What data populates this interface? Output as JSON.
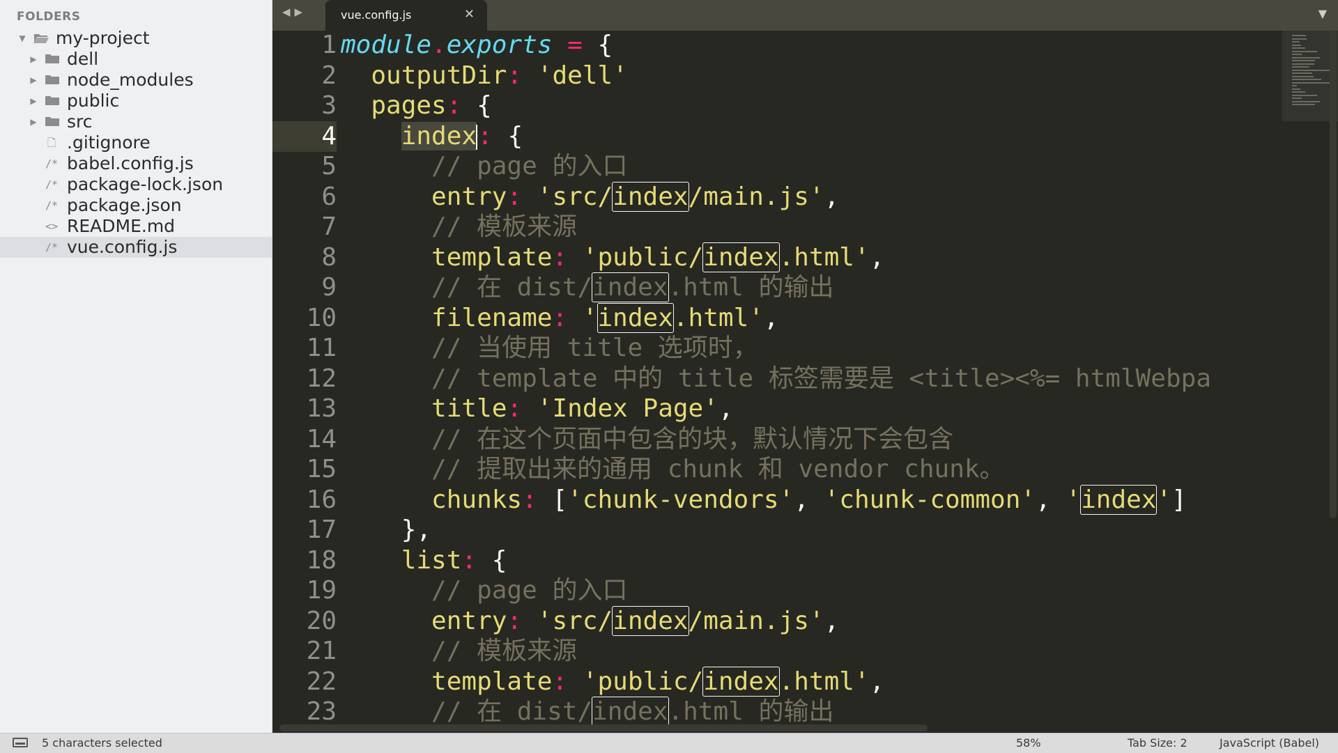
{
  "sidebar": {
    "header": "FOLDERS",
    "items": [
      {
        "label": "my-project",
        "type": "folder-open",
        "depth": 0
      },
      {
        "label": "dell",
        "type": "folder",
        "depth": 1
      },
      {
        "label": "node_modules",
        "type": "folder",
        "depth": 1
      },
      {
        "label": "public",
        "type": "folder",
        "depth": 1
      },
      {
        "label": "src",
        "type": "folder",
        "depth": 1
      },
      {
        "label": ".gitignore",
        "type": "file",
        "icon_glyph": "🗋",
        "depth": 1
      },
      {
        "label": "babel.config.js",
        "type": "file",
        "icon_glyph": "/*",
        "depth": 1
      },
      {
        "label": "package-lock.json",
        "type": "file",
        "icon_glyph": "/*",
        "depth": 1
      },
      {
        "label": "package.json",
        "type": "file",
        "icon_glyph": "/*",
        "depth": 1
      },
      {
        "label": "README.md",
        "type": "file",
        "icon_glyph": "<>",
        "depth": 1
      },
      {
        "label": "vue.config.js",
        "type": "file",
        "icon_glyph": "/*",
        "depth": 1,
        "selected": true
      }
    ]
  },
  "tabbar": {
    "nav_back": "◀",
    "nav_forward": "▶",
    "active_tab": "vue.config.js",
    "close_glyph": "✕",
    "dropdown_glyph": "▼"
  },
  "editor": {
    "current_line": 4,
    "lines": [
      {
        "n": "1",
        "tokens": [
          [
            "kw",
            "module"
          ],
          [
            "op",
            "."
          ],
          [
            "kw",
            "exports"
          ],
          [
            "punc",
            " "
          ],
          [
            "op",
            "="
          ],
          [
            "punc",
            " {"
          ]
        ]
      },
      {
        "n": "2",
        "tokens": [
          [
            "punc",
            "  "
          ],
          [
            "key",
            "outputDir"
          ],
          [
            "op",
            ":"
          ],
          [
            "punc",
            " "
          ],
          [
            "str",
            "'dell'"
          ]
        ]
      },
      {
        "n": "3",
        "tokens": [
          [
            "punc",
            "  "
          ],
          [
            "key",
            "pages"
          ],
          [
            "op",
            ":"
          ],
          [
            "punc",
            " {"
          ]
        ]
      },
      {
        "n": "4",
        "tokens": [
          [
            "punc",
            "    "
          ],
          [
            "sel",
            "index"
          ],
          [
            "caret",
            ""
          ],
          [
            "op",
            ":"
          ],
          [
            "punc",
            " {"
          ]
        ]
      },
      {
        "n": "5",
        "tokens": [
          [
            "punc",
            "      "
          ],
          [
            "cm",
            "// page 的入口"
          ]
        ]
      },
      {
        "n": "6",
        "tokens": [
          [
            "punc",
            "      "
          ],
          [
            "key",
            "entry"
          ],
          [
            "op",
            ":"
          ],
          [
            "punc",
            " "
          ],
          [
            "str",
            "'src/"
          ],
          [
            "hl",
            "index"
          ],
          [
            "str",
            "/main.js'"
          ],
          [
            "punc",
            ","
          ]
        ]
      },
      {
        "n": "7",
        "tokens": [
          [
            "punc",
            "      "
          ],
          [
            "cm",
            "// 模板来源"
          ]
        ]
      },
      {
        "n": "8",
        "tokens": [
          [
            "punc",
            "      "
          ],
          [
            "key",
            "template"
          ],
          [
            "op",
            ":"
          ],
          [
            "punc",
            " "
          ],
          [
            "str",
            "'public/"
          ],
          [
            "hl",
            "index"
          ],
          [
            "str",
            ".html'"
          ],
          [
            "punc",
            ","
          ]
        ]
      },
      {
        "n": "9",
        "tokens": [
          [
            "punc",
            "      "
          ],
          [
            "cm",
            "// 在 dist/"
          ],
          [
            "hlcm",
            "index"
          ],
          [
            "cm",
            ".html 的输出"
          ]
        ]
      },
      {
        "n": "10",
        "tokens": [
          [
            "punc",
            "      "
          ],
          [
            "key",
            "filename"
          ],
          [
            "op",
            ":"
          ],
          [
            "punc",
            " "
          ],
          [
            "str",
            "'"
          ],
          [
            "hl",
            "index"
          ],
          [
            "str",
            ".html'"
          ],
          [
            "punc",
            ","
          ]
        ]
      },
      {
        "n": "11",
        "tokens": [
          [
            "punc",
            "      "
          ],
          [
            "cm",
            "// 当使用 title 选项时，"
          ]
        ]
      },
      {
        "n": "12",
        "tokens": [
          [
            "punc",
            "      "
          ],
          [
            "cm",
            "// template 中的 title 标签需要是 <title><%= htmlWebpa"
          ]
        ]
      },
      {
        "n": "13",
        "tokens": [
          [
            "punc",
            "      "
          ],
          [
            "key",
            "title"
          ],
          [
            "op",
            ":"
          ],
          [
            "punc",
            " "
          ],
          [
            "str",
            "'Index Page'"
          ],
          [
            "punc",
            ","
          ]
        ]
      },
      {
        "n": "14",
        "tokens": [
          [
            "punc",
            "      "
          ],
          [
            "cm",
            "// 在这个页面中包含的块，默认情况下会包含"
          ]
        ]
      },
      {
        "n": "15",
        "tokens": [
          [
            "punc",
            "      "
          ],
          [
            "cm",
            "// 提取出来的通用 chunk 和 vendor chunk。"
          ]
        ]
      },
      {
        "n": "16",
        "tokens": [
          [
            "punc",
            "      "
          ],
          [
            "key",
            "chunks"
          ],
          [
            "op",
            ":"
          ],
          [
            "punc",
            " ["
          ],
          [
            "str",
            "'chunk-vendors'"
          ],
          [
            "punc",
            ", "
          ],
          [
            "str",
            "'chunk-common'"
          ],
          [
            "punc",
            ", "
          ],
          [
            "str",
            "'"
          ],
          [
            "hl",
            "index"
          ],
          [
            "str",
            "'"
          ],
          [
            "punc",
            "]"
          ]
        ]
      },
      {
        "n": "17",
        "tokens": [
          [
            "punc",
            "    },"
          ]
        ]
      },
      {
        "n": "18",
        "tokens": [
          [
            "punc",
            "    "
          ],
          [
            "key",
            "list"
          ],
          [
            "op",
            ":"
          ],
          [
            "punc",
            " {"
          ]
        ]
      },
      {
        "n": "19",
        "tokens": [
          [
            "punc",
            "      "
          ],
          [
            "cm",
            "// page 的入口"
          ]
        ]
      },
      {
        "n": "20",
        "tokens": [
          [
            "punc",
            "      "
          ],
          [
            "key",
            "entry"
          ],
          [
            "op",
            ":"
          ],
          [
            "punc",
            " "
          ],
          [
            "str",
            "'src/"
          ],
          [
            "hl",
            "index"
          ],
          [
            "str",
            "/main.js'"
          ],
          [
            "punc",
            ","
          ]
        ]
      },
      {
        "n": "21",
        "tokens": [
          [
            "punc",
            "      "
          ],
          [
            "cm",
            "// 模板来源"
          ]
        ]
      },
      {
        "n": "22",
        "tokens": [
          [
            "punc",
            "      "
          ],
          [
            "key",
            "template"
          ],
          [
            "op",
            ":"
          ],
          [
            "punc",
            " "
          ],
          [
            "str",
            "'public/"
          ],
          [
            "hl",
            "index"
          ],
          [
            "str",
            ".html'"
          ],
          [
            "punc",
            ","
          ]
        ]
      },
      {
        "n": "23",
        "tokens": [
          [
            "punc",
            "      "
          ],
          [
            "cm",
            "// 在 dist/"
          ],
          [
            "hlcm",
            "index"
          ],
          [
            "cm",
            ".html 的输出"
          ]
        ]
      }
    ]
  },
  "statusbar": {
    "selection": "5 characters selected",
    "zoom": "58%",
    "tab_size": "Tab Size: 2",
    "syntax": "JavaScript (Babel)"
  },
  "colors": {
    "background": "#272822",
    "keyword": "#66d9ef",
    "operator": "#f92672",
    "string": "#e6db74",
    "comment": "#75715e",
    "text": "#f8f8f2",
    "sidebar_bg": "#eff0f2"
  }
}
